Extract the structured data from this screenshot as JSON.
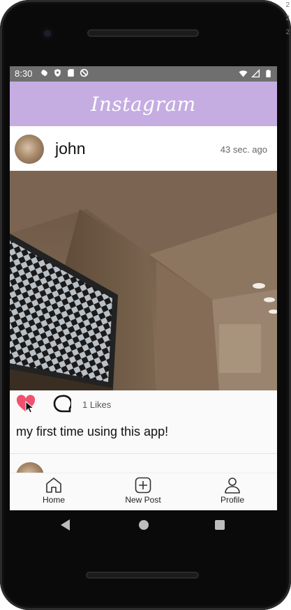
{
  "device_frame": {
    "side_markers": [
      "2",
      "2",
      "2"
    ]
  },
  "status_bar": {
    "time": "8:30",
    "left_icons": [
      "gear-icon",
      "shield-icon",
      "sd-card-icon",
      "sync-blocked-icon"
    ],
    "right_icons": [
      "wifi-icon",
      "signal-icon",
      "battery-icon"
    ]
  },
  "app_bar": {
    "title": "Instagram",
    "color": "#c5ade2"
  },
  "post": {
    "username": "john",
    "timestamp": "43 sec. ago",
    "likes_text": "1 Likes",
    "caption": "my first time using this app!",
    "liked": true,
    "like_color": "#f0516f"
  },
  "bottom_nav": {
    "items": [
      {
        "label": "Home",
        "icon": "home-icon"
      },
      {
        "label": "New Post",
        "icon": "add-square-icon"
      },
      {
        "label": "Profile",
        "icon": "profile-icon"
      }
    ]
  },
  "system_nav": {
    "buttons": [
      "back-icon",
      "home-circle-icon",
      "recents-icon"
    ]
  }
}
